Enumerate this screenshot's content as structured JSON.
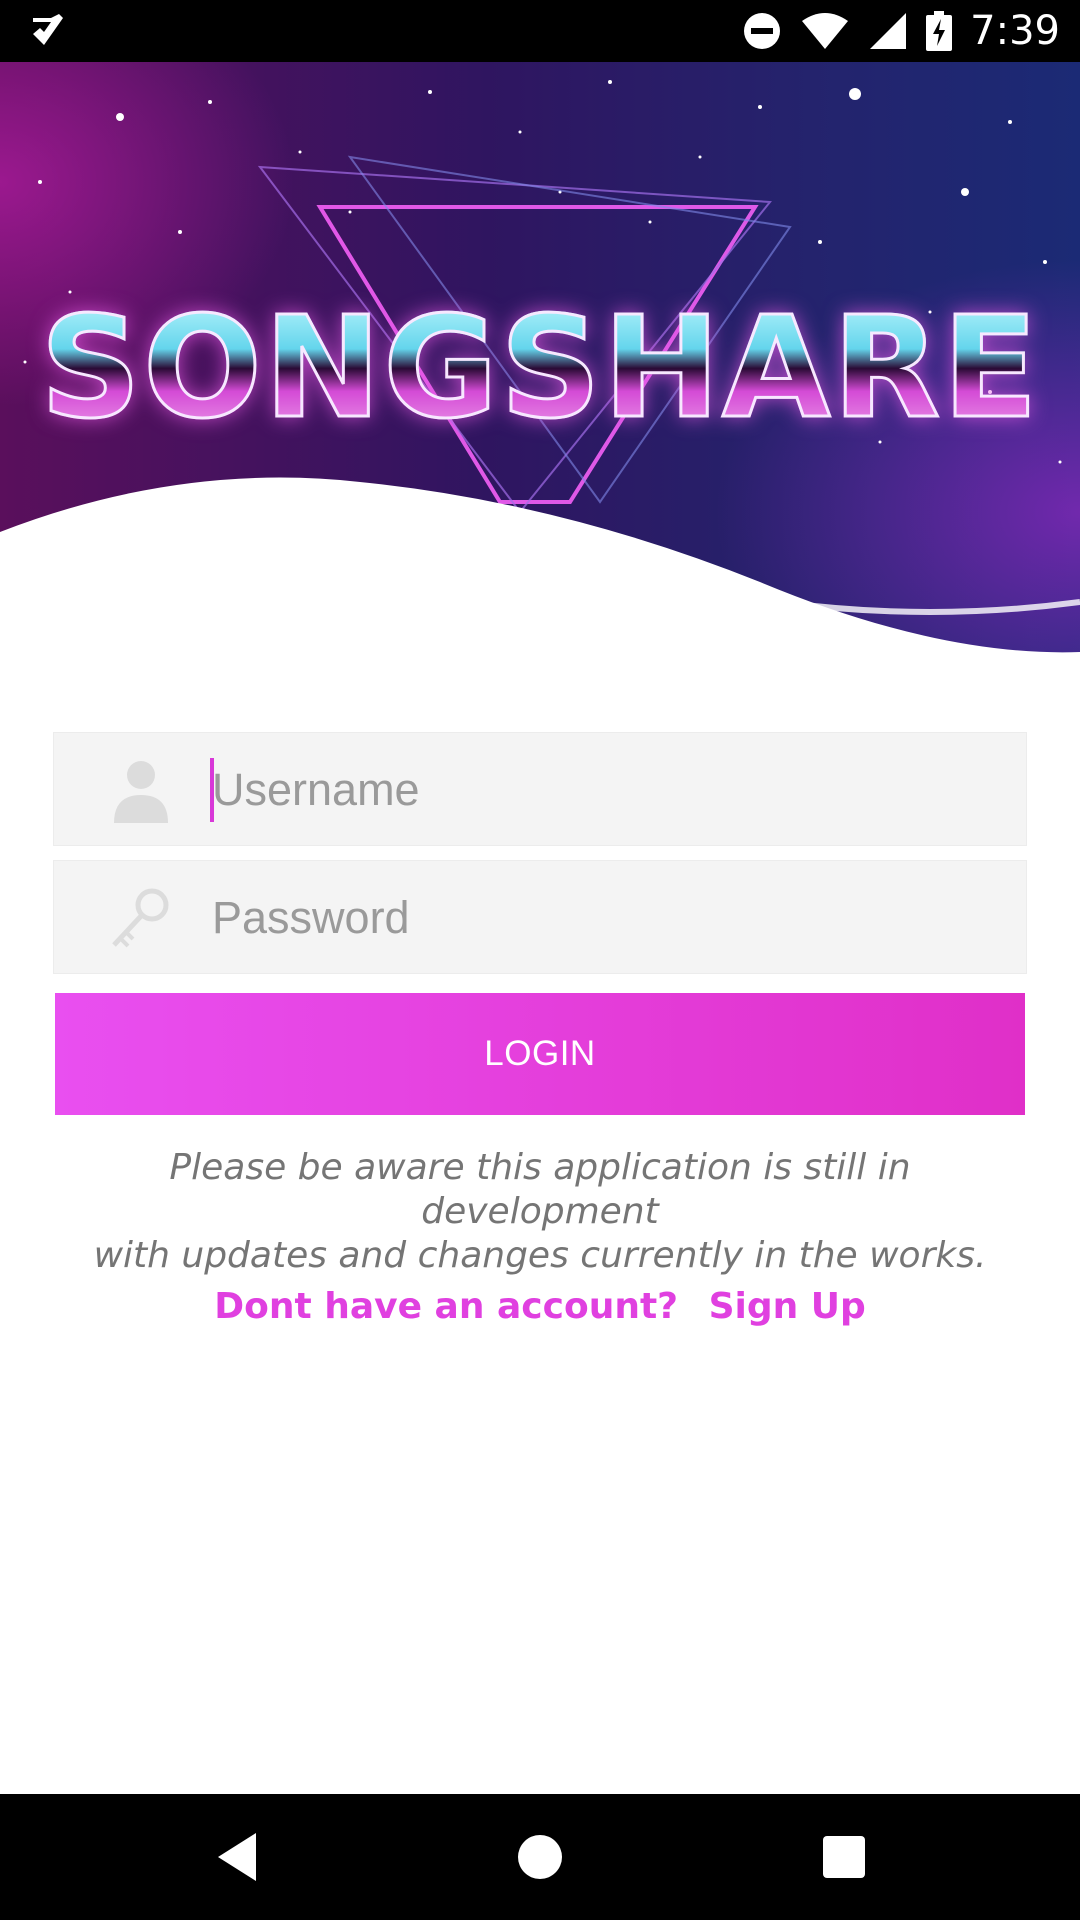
{
  "status_bar": {
    "time": "7:39",
    "icons": [
      "check-notification-icon",
      "do-not-disturb-icon",
      "wifi-icon",
      "cell-signal-icon",
      "battery-charging-icon"
    ]
  },
  "hero": {
    "logo_text": "SONGSHARE"
  },
  "form": {
    "username_placeholder": "Username",
    "password_placeholder": "Password",
    "login_label": "LOGIN"
  },
  "notice": {
    "line1": "Please be aware this application is still in development",
    "line2": "with updates and changes currently in the works."
  },
  "signup": {
    "prompt": "Dont have an account?",
    "link": "Sign Up"
  },
  "nav_bar": {
    "icons": [
      "back-icon",
      "home-icon",
      "recents-icon"
    ]
  },
  "colors": {
    "accent": "#e040e0",
    "button_start": "#e94ff0",
    "button_end": "#e02fc8"
  }
}
